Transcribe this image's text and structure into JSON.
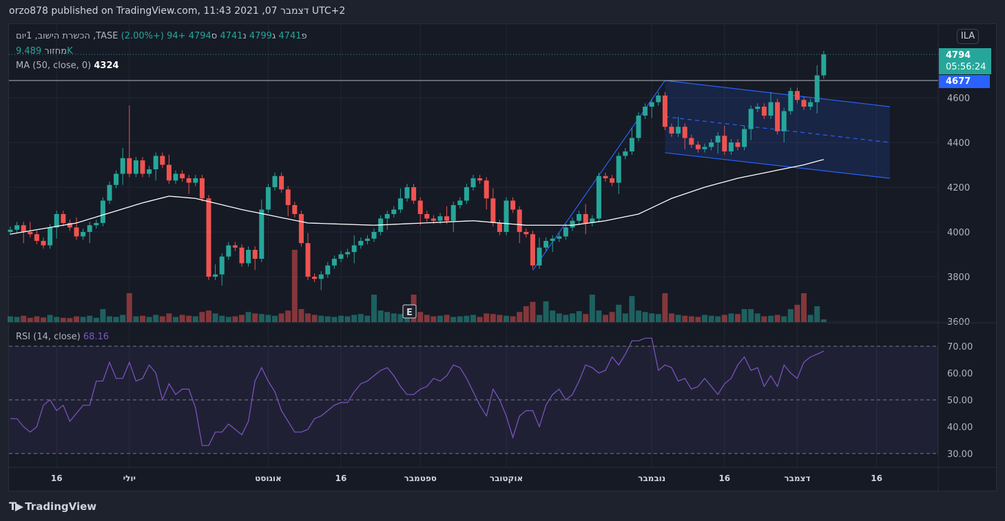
{
  "publish": "orzo878 published on TradingView.com, 11:43 2021 ,07 דצמבר UTC+2",
  "legend": {
    "symbol": "הכשרת הישוב, 1יום ,TASE",
    "o_label": "פ",
    "o": "4741",
    "h_label": "ג",
    "h": "4799",
    "l_label": "נ",
    "l": "4741",
    "c_label": "ס",
    "c": "4794",
    "change": "+94 (+2.00%)",
    "volume_label": "מחזור",
    "volume": "9.489K",
    "ma_label": "MA (50, close, 0)",
    "ma_value": "4324"
  },
  "currency": "ILA",
  "last_price": {
    "value": "4794",
    "countdown": "05:56:24"
  },
  "hline_price": {
    "value": "4677"
  },
  "rsi": {
    "label": "RSI (14, close)",
    "value": "68.16"
  },
  "footer": {
    "brand": "TradingView"
  },
  "colors": {
    "up": "#26a69a",
    "down": "#ef5350",
    "ma": "#ffffff",
    "rsi": "#7e57c2",
    "drawing": "#2962ff"
  },
  "chart_data": {
    "type": "candlestick",
    "y_ticks": [
      3600,
      3800,
      4000,
      4200,
      4400,
      4600
    ],
    "rsi_ticks": [
      "30.00",
      "40.00",
      "50.00",
      "60.00",
      "70.00"
    ],
    "x_labels": [
      {
        "i": 7,
        "t": "16"
      },
      {
        "i": 18,
        "t": "יולי"
      },
      {
        "i": 39,
        "t": "אוגוסט"
      },
      {
        "i": 50,
        "t": "16"
      },
      {
        "i": 62,
        "t": "ספטמבר"
      },
      {
        "i": 75,
        "t": "אוקטובר"
      },
      {
        "i": 97,
        "t": "נובמבר"
      },
      {
        "i": 108,
        "t": "16"
      },
      {
        "i": 119,
        "t": "דצמבר"
      },
      {
        "i": 131,
        "t": "16"
      }
    ],
    "close": [
      4010,
      4030,
      4000,
      3990,
      3960,
      3940,
      4020,
      4080,
      4040,
      4020,
      3980,
      4000,
      4030,
      4040,
      4140,
      4210,
      4260,
      4330,
      4260,
      4320,
      4260,
      4280,
      4340,
      4300,
      4230,
      4260,
      4240,
      4220,
      4240,
      4150,
      3800,
      3810,
      3890,
      3940,
      3930,
      3860,
      3920,
      3880,
      4100,
      4200,
      4250,
      4190,
      4120,
      4080,
      3950,
      3800,
      3790,
      3810,
      3850,
      3880,
      3900,
      3910,
      3940,
      3960,
      3970,
      4000,
      4060,
      4080,
      4100,
      4150,
      4200,
      4140,
      4080,
      4060,
      4050,
      4070,
      4050,
      4120,
      4140,
      4200,
      4240,
      4230,
      4150,
      4040,
      4000,
      4140,
      4100,
      4000,
      3990,
      3850,
      3930,
      3960,
      3970,
      3980,
      4020,
      4050,
      4080,
      4040,
      4060,
      4250,
      4240,
      4220,
      4340,
      4360,
      4420,
      4520,
      4560,
      4580,
      4610,
      4470,
      4440,
      4470,
      4420,
      4390,
      4370,
      4380,
      4400,
      4430,
      4360,
      4400,
      4380,
      4460,
      4550,
      4560,
      4520,
      4580,
      4450,
      4540,
      4630,
      4590,
      4560,
      4580,
      4700,
      4794
    ],
    "volume_k": [
      20,
      18,
      22,
      15,
      20,
      16,
      25,
      18,
      15,
      14,
      20,
      18,
      22,
      15,
      45,
      20,
      18,
      25,
      100,
      20,
      22,
      18,
      25,
      20,
      30,
      18,
      25,
      22,
      20,
      35,
      40,
      30,
      22,
      18,
      20,
      25,
      35,
      30,
      28,
      25,
      22,
      30,
      40,
      250,
      45,
      30,
      25,
      22,
      20,
      18,
      22,
      20,
      25,
      28,
      22,
      95,
      40,
      35,
      30,
      28,
      25,
      95,
      35,
      25,
      20,
      22,
      25,
      18,
      20,
      22,
      25,
      18,
      30,
      28,
      25,
      22,
      20,
      35,
      55,
      70,
      25,
      72,
      40,
      30,
      25,
      30,
      38,
      28,
      95,
      40,
      25,
      35,
      60,
      30,
      90,
      40,
      35,
      30,
      28,
      100,
      30,
      25,
      22,
      20,
      18,
      25,
      22,
      20,
      25,
      30,
      28,
      45,
      45,
      30,
      20,
      22,
      25,
      20,
      45,
      60,
      100,
      25,
      55,
      9.5
    ],
    "ma_points": [
      [
        0,
        3990
      ],
      [
        10,
        4040
      ],
      [
        20,
        4130
      ],
      [
        24,
        4160
      ],
      [
        28,
        4150
      ],
      [
        35,
        4100
      ],
      [
        45,
        4040
      ],
      [
        55,
        4030
      ],
      [
        70,
        4050
      ],
      [
        78,
        4030
      ],
      [
        85,
        4030
      ],
      [
        90,
        4050
      ],
      [
        95,
        4080
      ],
      [
        100,
        4150
      ],
      [
        105,
        4200
      ],
      [
        110,
        4240
      ],
      [
        115,
        4270
      ],
      [
        120,
        4300
      ],
      [
        123,
        4324
      ]
    ],
    "rsi": [
      43,
      43,
      40,
      38,
      40,
      48,
      50,
      46,
      48,
      42,
      45,
      48,
      48,
      57,
      57,
      64,
      58,
      58,
      64,
      57,
      58,
      63,
      60,
      50,
      56,
      52,
      54,
      54,
      47,
      33,
      33,
      38,
      38,
      41,
      39,
      37,
      42,
      57,
      62,
      57,
      53,
      46,
      42,
      38,
      38,
      39,
      43,
      44,
      46,
      48,
      49,
      49,
      53,
      56,
      57,
      59,
      61,
      62,
      59,
      55,
      52,
      52,
      54,
      55,
      58,
      57,
      59,
      63,
      62,
      58,
      53,
      48,
      44,
      54,
      50,
      44,
      36,
      44,
      46,
      46,
      40,
      48,
      52,
      54,
      50,
      52,
      57,
      63,
      62,
      60,
      61,
      66,
      63,
      67,
      72,
      72,
      73,
      73,
      61,
      63,
      62,
      57,
      58,
      54,
      55,
      58,
      55,
      52,
      56,
      58,
      63,
      66,
      61,
      62,
      55,
      59,
      55,
      63,
      60,
      58,
      64,
      66,
      67,
      68.16
    ],
    "trendline": [
      [
        79,
        3828
      ],
      [
        99,
        4677
      ]
    ],
    "channel": {
      "upper": [
        [
          99,
          4677
        ],
        [
          133,
          4560
        ]
      ],
      "lower": [
        [
          99,
          4354
        ],
        [
          133,
          4240
        ]
      ],
      "mid": [
        [
          99,
          4515
        ],
        [
          133,
          4400
        ]
      ]
    }
  }
}
